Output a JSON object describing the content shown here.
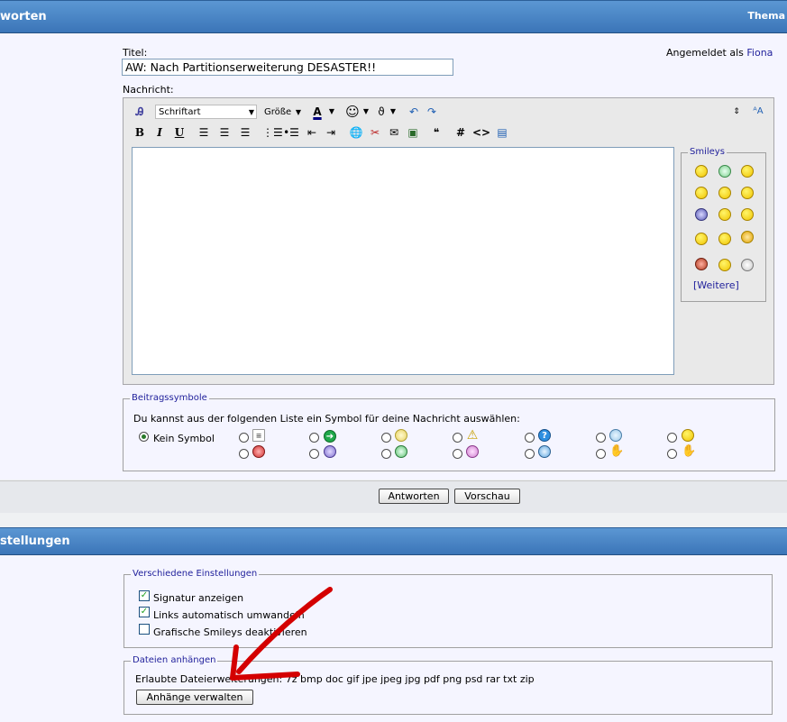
{
  "header": {
    "title": "worten",
    "right": "Thema"
  },
  "form": {
    "title_label": "Titel:",
    "title_value": "AW: Nach Partitionserweiterung DESASTER!!",
    "login_prefix": "Angemeldet als",
    "login_user": "Fiona",
    "message_label": "Nachricht:"
  },
  "toolbar": {
    "font_select": "Schriftart",
    "size_select": "Größe",
    "bold": "B",
    "italic": "I",
    "underline": "U",
    "hash": "#",
    "code": "<>"
  },
  "smileys": {
    "legend": "Smileys",
    "more_open": "[",
    "more": "Weitere",
    "more_close": "]"
  },
  "post_icons": {
    "legend": "Beitragssymbole",
    "intro": "Du kannst aus der folgenden Liste ein Symbol für deine Nachricht auswählen:",
    "none_label": "Kein Symbol"
  },
  "buttons": {
    "reply": "Antworten",
    "preview": "Vorschau"
  },
  "settings_bar": {
    "title": "stellungen"
  },
  "settings": {
    "misc_legend": "Verschiedene Einstellungen",
    "options": [
      {
        "label": "Signatur anzeigen",
        "checked": true
      },
      {
        "label": "Links automatisch umwandeln",
        "checked": true
      },
      {
        "label": "Grafische Smileys deaktivieren",
        "checked": false
      }
    ],
    "attach_legend": "Dateien anhängen",
    "allowed_text": "Erlaubte Dateierweiterungen: 7z bmp doc gif jpe jpeg jpg pdf png psd rar txt zip",
    "manage_button": "Anhänge verwalten"
  },
  "colors": {
    "bar": "#3b75b8",
    "link": "#22229c",
    "annotation": "#d40000"
  }
}
